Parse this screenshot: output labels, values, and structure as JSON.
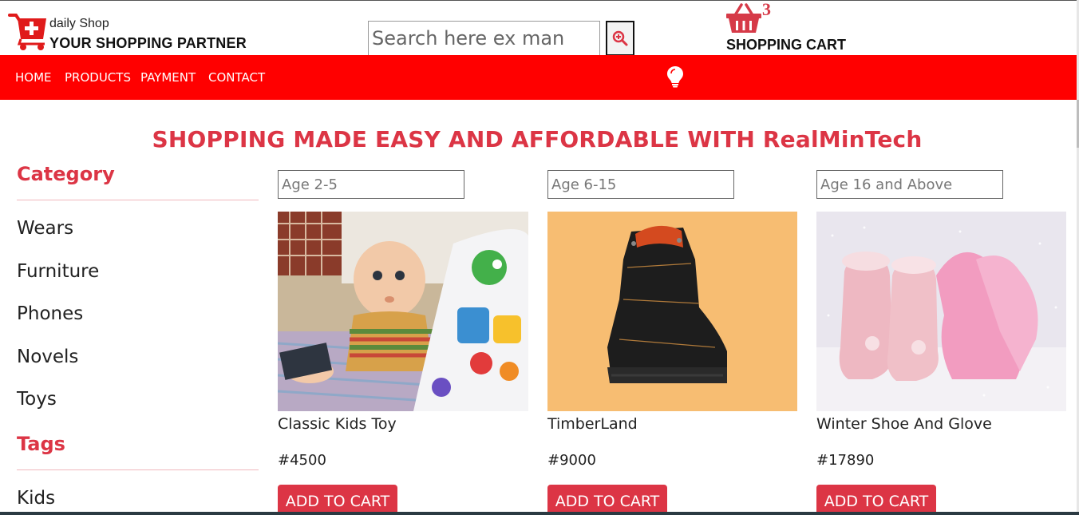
{
  "header": {
    "brand_small": "daily Shop",
    "brand_big": "YOUR SHOPPING PARTNER",
    "logo_icon": "cart-plus-icon",
    "search_placeholder": "Search here ex man",
    "search_icon": "zoom-in-icon",
    "cart_icon": "basket-icon",
    "cart_count": "3",
    "cart_label": "SHOPPING CART"
  },
  "nav": {
    "items": [
      "HOME",
      "PRODUCTS",
      "PAYMENT",
      "CONTACT"
    ],
    "bulb_icon": "lightbulb-icon"
  },
  "headline": "SHOPPING MADE EASY AND AFFORDABLE WITH RealMinTech",
  "sidebar": {
    "category_title": "Category",
    "categories": [
      "Wears",
      "Furniture",
      "Phones",
      "Novels",
      "Toys"
    ],
    "tags_title": "Tags",
    "tags": [
      "Kids"
    ]
  },
  "products": [
    {
      "age_placeholder": "Age 2-5",
      "name": "Classic Kids Toy",
      "price": "#4500",
      "button": "ADD TO CART"
    },
    {
      "age_placeholder": "Age 6-15",
      "name": "TimberLand",
      "price": "#9000",
      "button": "ADD TO CART"
    },
    {
      "age_placeholder": "Age 16 and Above",
      "name": "Winter Shoe And Glove",
      "price": "#17890",
      "button": "ADD TO CART"
    }
  ],
  "colors": {
    "brand_red": "#ff0000",
    "accent": "#dc3545"
  }
}
